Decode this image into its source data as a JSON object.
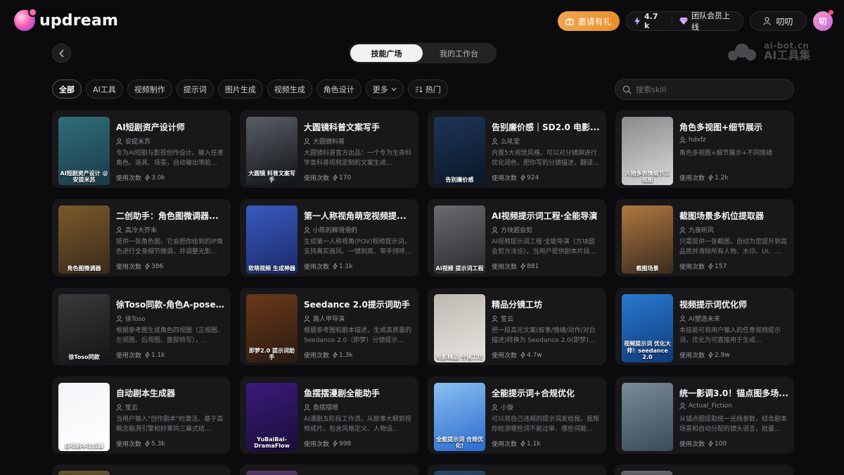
{
  "header": {
    "brand": "updream",
    "invite_label": "邀请有礼",
    "points": "4.7 k",
    "team_label": "团队会员上线",
    "username": "叨叨",
    "avatar_initial": "叨"
  },
  "tabs": [
    {
      "label": "技能广场",
      "active": true
    },
    {
      "label": "我的工作台",
      "active": false
    }
  ],
  "watermark": {
    "line1": "ai-bot.cn",
    "line2": "AI工具集"
  },
  "filters": [
    {
      "label": "全部",
      "active": true
    },
    {
      "label": "AI工具"
    },
    {
      "label": "视频制作"
    },
    {
      "label": "提示词"
    },
    {
      "label": "图片生成"
    },
    {
      "label": "视频生成"
    },
    {
      "label": "角色设计"
    },
    {
      "label": "更多"
    },
    {
      "label": "热门"
    }
  ],
  "search": {
    "placeholder": "搜索skill"
  },
  "usage_label": "使用次数",
  "cards": [
    {
      "title": "AI短剧资产设计师",
      "author": "安提米苏",
      "desc": "专为AI短剧与影视创作设计。输入任意角色、道具、场景，自动输出带脸...",
      "count": "3.0k",
      "thumb_text": "AI短剧资产设计 @安提米苏",
      "thumb_colors": [
        "#1b3a48",
        "#2f6f7a"
      ]
    },
    {
      "title": "大圆镜科普文案写手",
      "author": "大圆镜科普",
      "desc": "大圆镜科普官方出品：一个专为生命科学类科普视频定制的文案生成...",
      "count": "170",
      "thumb_text": "大圆镜 科普文案写手",
      "thumb_colors": [
        "#101418",
        "#5a5f66"
      ]
    },
    {
      "title": "告别廉价感｜SD2.0 电影...",
      "author": "么吼堂",
      "desc": "内置5大视觉风格，可以对分镜脚进行优化润色，肥你写的分镜描述，翻译...",
      "count": "924",
      "thumb_text": "告别廉价感",
      "thumb_colors": [
        "#0b1626",
        "#1e3558"
      ]
    },
    {
      "title": "角色多视图+细节展示",
      "author": "hdxfz",
      "desc": "角色多视图+细节展示+不同情绪",
      "count": "1.2k",
      "thumb_text": "人物多表情细节三视图",
      "thumb_colors": [
        "#d9d9d9",
        "#8a8a8a"
      ]
    },
    {
      "title": "二创助手：角色图微调器...",
      "author": "高冷大芥末",
      "desc": "提供一张角色图，它会把你给到的IP角色进行全身细节微调，并调整光影...",
      "count": "386",
      "thumb_text": "角色图微调器",
      "thumb_colors": [
        "#3a2a1a",
        "#7a5a2a"
      ]
    },
    {
      "title": "第一人称视角萌宠视频提...",
      "author": "小陈的脚滑滑的",
      "desc": "生成第一人称视角(POV)视频提示词，支持真实画风、一镜到底、带手持呼...",
      "count": "1.1k",
      "thumb_text": "软萌视频 生成神器",
      "thumb_colors": [
        "#1a2a6a",
        "#3a5ac0"
      ]
    },
    {
      "title": "AI视频提示词工程·全能导演",
      "author": "方块超会剪",
      "desc": "AI视频提示词工程·全能导演（方块超会剪方法论）。当用户提供剧本片段...",
      "count": "881",
      "thumb_text": "AI视频 提示词工程",
      "thumb_colors": [
        "#2a2a2e",
        "#6a6a70"
      ]
    },
    {
      "title": "截图场景多机位提取器",
      "author": "九夜听风",
      "desc": "只需提供一张截图，自动为您提升到高品质并清除所有人物、水印、UI、...",
      "count": "157",
      "thumb_text": "截图场景",
      "thumb_colors": [
        "#3a2a1e",
        "#b07840"
      ]
    },
    {
      "title": "徐Toso同款-角色A-pose四...",
      "author": "徐Toso",
      "desc": "根据参考图生成角色四视图（正视图、左视图、后视图、面部特写），...",
      "count": "1.1k",
      "thumb_text": "徐Toso同款",
      "thumb_colors": [
        "#151515",
        "#3a3a3a"
      ]
    },
    {
      "title": "Seedance 2.0提示词助手",
      "author": "路人甲导演",
      "desc": "根据参考图和剧本描述，生成高质量的 Seedance 2.0（即梦）分镜提示...",
      "count": "1.3k",
      "thumb_text": "即梦2.0 提示词助手",
      "thumb_colors": [
        "#2a1a10",
        "#6a3a1a"
      ]
    },
    {
      "title": "精品分镜工坊",
      "author": "笙云",
      "desc": "把一段高光文案(叙事/情绪/动作/对白描述)转换为 Seedance 2.0(即梦)可直...",
      "count": "4.7w",
      "thumb_text": "电影精品 分镜工坊",
      "thumb_colors": [
        "#e8e6e2",
        "#bdb8b0"
      ]
    },
    {
      "title": "视频提示词优化师",
      "author": "AI塑造未来",
      "desc": "本技能可将用户输入的任意视频提示词，优化为可直接用于生成...",
      "count": "2.9w",
      "thumb_text": "视频提示词 优化大师！seedance 2.0",
      "thumb_colors": [
        "#0e3a7a",
        "#2a7ad0"
      ]
    },
    {
      "title": "自动剧本生成器",
      "author": "笙云",
      "desc": "当用户输入\"创作剧本\"时激活。基于高概念脑洞引擎和好莱坞三幕式结...",
      "count": "5.3k",
      "thumb_text": "自动剧本生成器",
      "thumb_colors": [
        "#ffffff",
        "#f2f4f8"
      ]
    },
    {
      "title": "鱼摆摆漫剧全能助手",
      "author": "鱼摆摆嗯",
      "desc": "AI漫剧五阶段工作流，从故事大纲到视频成片。包含风格定义、人物设...",
      "count": "998",
      "thumb_text": "YuBaiBai-DramaFlow",
      "thumb_colors": [
        "#1a0e3a",
        "#3a1a7a"
      ]
    },
    {
      "title": "全能提示词+合规优化",
      "author": "小旋",
      "desc": "可以将自己违规的提示词发给我，我帮你检测哪些词不能过审、哪些词能...",
      "count": "1.1k",
      "thumb_text": "全能提示词 合规优化!",
      "thumb_colors": [
        "#2a6ad0",
        "#8ac0f0"
      ]
    },
    {
      "title": "统一影调3.0！锚点图多场...",
      "author": "Actual_Fiction",
      "desc": "从锚点图提取统一光线参数，结合剧本场景和自动分配的镜头语言，批量...",
      "count": "100",
      "thumb_text": "",
      "thumb_colors": [
        "#3a4a58",
        "#7a8a96"
      ]
    }
  ]
}
